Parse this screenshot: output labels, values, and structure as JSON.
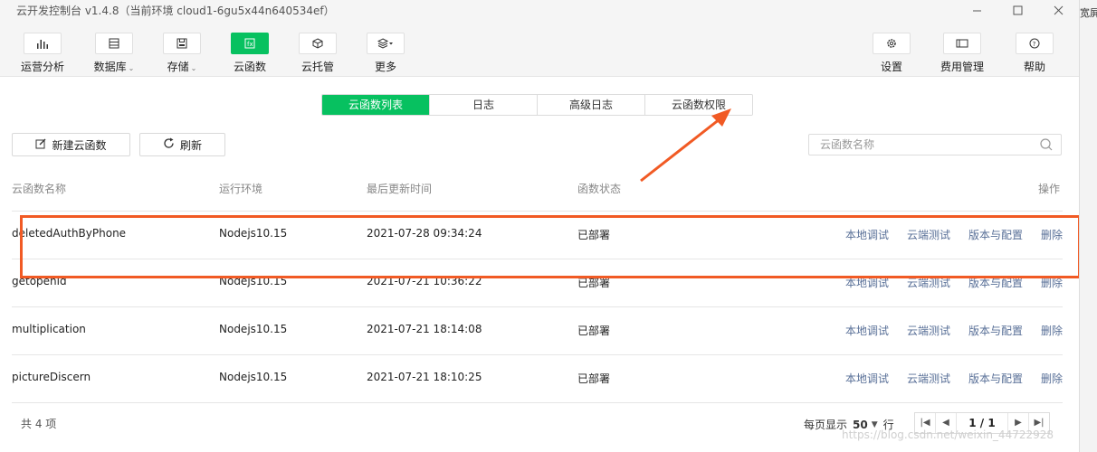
{
  "titlebar": {
    "title": "云开发控制台 v1.4.8（当前环境 cloud1-6gu5x44n640534ef）",
    "minimize_icon": "minimize-icon",
    "maximize_icon": "maximize-icon",
    "close_icon": "close-icon"
  },
  "right_strip": {
    "text": "宽屏"
  },
  "toolbar": {
    "items": [
      {
        "label": "运营分析",
        "icon": "bar-chart-icon",
        "active": false
      },
      {
        "label": "数据库",
        "icon": "database-icon",
        "active": false
      },
      {
        "label": "存储",
        "icon": "storage-icon",
        "active": false
      },
      {
        "label": "云函数",
        "icon": "function-icon",
        "active": true
      },
      {
        "label": "云托管",
        "icon": "cube-icon",
        "active": false
      },
      {
        "label": "更多",
        "icon": "layers-icon",
        "active": false
      },
      {
        "label": "设置",
        "icon": "gear-icon",
        "active": false
      },
      {
        "label": "费用管理",
        "icon": "card-icon",
        "active": false
      },
      {
        "label": "帮助",
        "icon": "help-icon",
        "active": false
      }
    ]
  },
  "tabs": [
    {
      "label": "云函数列表",
      "active": true
    },
    {
      "label": "日志",
      "active": false
    },
    {
      "label": "高级日志",
      "active": false
    },
    {
      "label": "云函数权限",
      "active": false
    }
  ],
  "actions": {
    "new_label": "新建云函数",
    "refresh_label": "刷新"
  },
  "search": {
    "placeholder": "云函数名称"
  },
  "table": {
    "headers": [
      "云函数名称",
      "运行环境",
      "最后更新时间",
      "函数状态",
      "操作"
    ],
    "rows": [
      {
        "name": "deletedAuthByPhone",
        "runtime": "Nodejs10.15",
        "updated": "2021-07-28 09:34:24",
        "status": "已部署"
      },
      {
        "name": "getopenid",
        "runtime": "Nodejs10.15",
        "updated": "2021-07-21 10:36:22",
        "status": "已部署"
      },
      {
        "name": "multiplication",
        "runtime": "Nodejs10.15",
        "updated": "2021-07-21 18:14:08",
        "status": "已部署"
      },
      {
        "name": "pictureDiscern",
        "runtime": "Nodejs10.15",
        "updated": "2021-07-21 18:10:25",
        "status": "已部署"
      }
    ],
    "ops": [
      "本地调试",
      "云端测试",
      "版本与配置",
      "删除"
    ]
  },
  "footer": {
    "total": "共 4 项",
    "per_page_label": "每页显示",
    "per_page_value": "50",
    "per_page_unit": "行",
    "page_indicator": "1 / 1"
  },
  "watermark": "https://blog.csdn.net/weixin_44722928",
  "colors": {
    "accent": "#07c160",
    "link": "#586f97",
    "annotation": "#f15a24"
  }
}
